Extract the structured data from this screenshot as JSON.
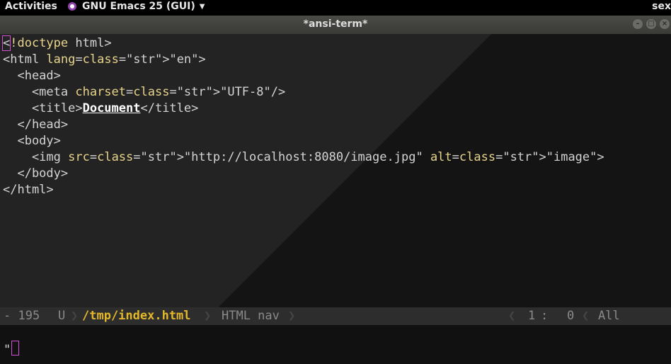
{
  "topbar": {
    "activities": "Activities",
    "app_name": "GNU Emacs 25 (GUI)",
    "app_icon": "emacs-icon",
    "right_text": "sex"
  },
  "window": {
    "title": "*ansi-term*",
    "buttons": [
      "minimize",
      "maximize",
      "close"
    ]
  },
  "editor": {
    "lines": [
      "<!doctype html>",
      "<html lang=\"en\">",
      "  <head>",
      "    <meta charset=\"UTF-8\"/>",
      "    <title>Document</title>",
      "  </head>",
      "  <body>",
      "    <img src=\"http://localhost:8080/image.jpg\" alt=\"image\">",
      "  </body>",
      "</html>"
    ]
  },
  "modeline": {
    "status": "- 195",
    "encoding": "U",
    "file": "/tmp/index.html",
    "mode": "HTML nav",
    "line": "1",
    "col": "0",
    "position": "All"
  },
  "minibuffer": {
    "text": "\""
  },
  "colors": {
    "tag": "#e8e8e8",
    "attribute": "#e8d48c",
    "string": "#e0505f",
    "file": "#e5b82a",
    "cursor": "#d450d4"
  }
}
